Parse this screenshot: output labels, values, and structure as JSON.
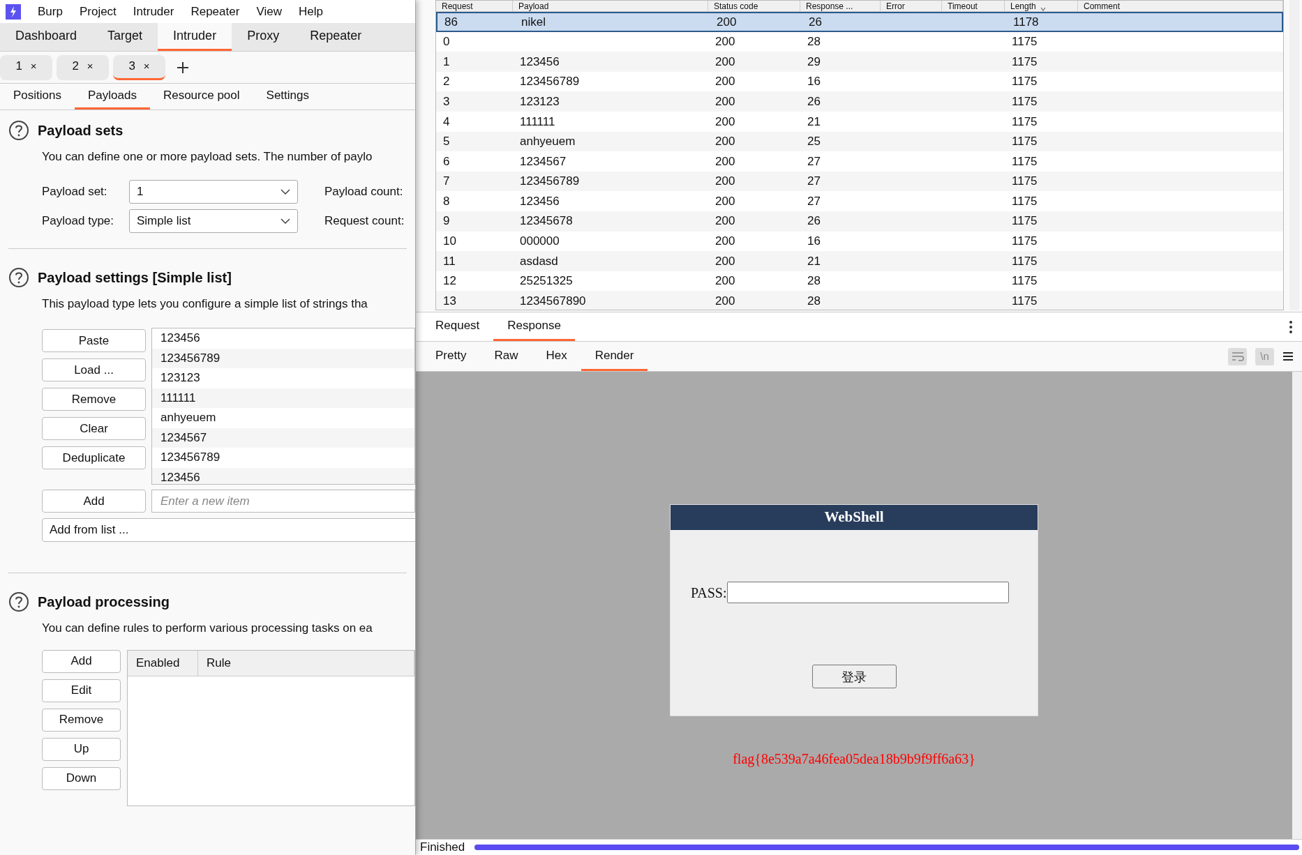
{
  "menu": [
    "Burp",
    "Project",
    "Intruder",
    "Repeater",
    "View",
    "Help"
  ],
  "main_tabs": [
    {
      "label": "Dashboard",
      "selected": false
    },
    {
      "label": "Target",
      "selected": false
    },
    {
      "label": "Intruder",
      "selected": true
    },
    {
      "label": "Proxy",
      "selected": false
    },
    {
      "label": "Repeater",
      "selected": false
    }
  ],
  "attack_tabs": [
    {
      "label": "1",
      "close": "×",
      "selected": false
    },
    {
      "label": "2",
      "close": "×",
      "selected": false
    },
    {
      "label": "3",
      "close": "×",
      "selected": true
    }
  ],
  "sub_tabs": [
    {
      "label": "Positions",
      "selected": false
    },
    {
      "label": "Payloads",
      "selected": true
    },
    {
      "label": "Resource pool",
      "selected": false
    },
    {
      "label": "Settings",
      "selected": false
    }
  ],
  "payload_sets": {
    "title": "Payload sets",
    "description": "You can define one or more payload sets. The number of paylo",
    "payload_set_label": "Payload set:",
    "payload_set": "1",
    "payload_type_label": "Payload type:",
    "payload_type": "Simple list",
    "payload_count_label": "Payload count:",
    "request_count_label": "Request count:"
  },
  "payload_settings": {
    "title": "Payload settings [Simple list]",
    "description": "This payload type lets you configure a simple list of strings tha",
    "buttons": [
      "Paste",
      "Load ...",
      "Remove",
      "Clear",
      "Deduplicate"
    ],
    "items": [
      "123456",
      "123456789",
      "123123",
      "111111",
      "anhyeuem",
      "1234567",
      "123456789",
      "123456"
    ],
    "add_button": "Add",
    "add_placeholder": "Enter a new item",
    "add_from_list": "Add from list ..."
  },
  "payload_processing": {
    "title": "Payload processing",
    "description": "You can define rules to perform various processing tasks on ea",
    "buttons": [
      "Add",
      "Edit",
      "Remove",
      "Up",
      "Down"
    ],
    "columns": [
      "Enabled",
      "Rule"
    ]
  },
  "results": {
    "columns": [
      "Request",
      "Payload",
      "Status code",
      "Response ...",
      "Error",
      "Timeout",
      "Length",
      "Comment"
    ],
    "rows": [
      {
        "request": "86",
        "payload": "nikel",
        "status_code": "200",
        "response_received": "26",
        "length": "1178",
        "selected": true
      },
      {
        "request": "0",
        "status_code": "200",
        "response_received": "28",
        "length": "1175",
        "selected": false
      },
      {
        "request": "1",
        "payload": "123456",
        "status_code": "200",
        "response_received": "29",
        "length": "1175",
        "selected": false
      },
      {
        "request": "2",
        "payload": "123456789",
        "status_code": "200",
        "response_received": "16",
        "length": "1175",
        "selected": false
      },
      {
        "request": "3",
        "payload": "123123",
        "status_code": "200",
        "response_received": "26",
        "length": "1175",
        "selected": false
      },
      {
        "request": "4",
        "payload": "111111",
        "status_code": "200",
        "response_received": "21",
        "length": "1175",
        "selected": false
      },
      {
        "request": "5",
        "payload": "anhyeuem",
        "status_code": "200",
        "response_received": "25",
        "length": "1175",
        "selected": false
      },
      {
        "request": "6",
        "payload": "1234567",
        "status_code": "200",
        "response_received": "27",
        "length": "1175",
        "selected": false
      },
      {
        "request": "7",
        "payload": "123456789",
        "status_code": "200",
        "response_received": "27",
        "length": "1175",
        "selected": false
      },
      {
        "request": "8",
        "payload": "123456",
        "status_code": "200",
        "response_received": "27",
        "length": "1175",
        "selected": false
      },
      {
        "request": "9",
        "payload": "12345678",
        "status_code": "200",
        "response_received": "26",
        "length": "1175",
        "selected": false
      },
      {
        "request": "10",
        "payload": "000000",
        "status_code": "200",
        "response_received": "16",
        "length": "1175",
        "selected": false
      },
      {
        "request": "11",
        "payload": "asdasd",
        "status_code": "200",
        "response_received": "21",
        "length": "1175",
        "selected": false
      },
      {
        "request": "12",
        "payload": "25251325",
        "status_code": "200",
        "response_received": "28",
        "length": "1175",
        "selected": false
      },
      {
        "request": "13",
        "payload": "1234567890",
        "status_code": "200",
        "response_received": "28",
        "length": "1175",
        "selected": false
      }
    ]
  },
  "message_tabs": [
    {
      "label": "Request",
      "selected": false
    },
    {
      "label": "Response",
      "selected": true
    }
  ],
  "view_tabs": [
    {
      "label": "Pretty",
      "selected": false
    },
    {
      "label": "Raw",
      "selected": false
    },
    {
      "label": "Hex",
      "selected": false
    },
    {
      "label": "Render",
      "selected": true
    }
  ],
  "newline_toggle": "\\n",
  "render": {
    "title": "WebShell",
    "pass_label": "PASS:",
    "login_button": "登录",
    "flag": "flag{8e539a7a46fea05dea18b9b9f9ff6a63}"
  },
  "status": {
    "text": "Finished",
    "level": 1
  }
}
